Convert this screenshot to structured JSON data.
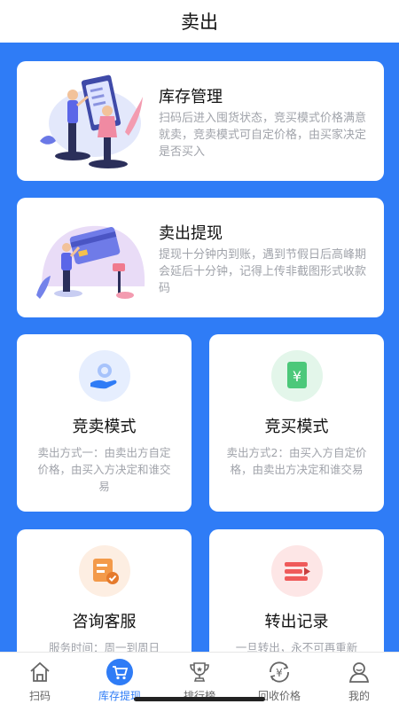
{
  "header": {
    "title": "卖出"
  },
  "cards": {
    "inventory": {
      "title": "库存管理",
      "desc": "扫码后进入囤货状态，竞买模式价格满意就卖，竞卖模式可自定价格，由买家决定是否买入"
    },
    "withdraw": {
      "title": "卖出提现",
      "desc": "提现十分钟内到账，遇到节假日后高峰期会延后十分钟，记得上传非截图形式收款码"
    },
    "auction_sell": {
      "title": "竞卖模式",
      "desc": "卖出方式一：由卖出方自定价格，由买入方决定和谁交易"
    },
    "auction_buy": {
      "title": "竞买模式",
      "desc": "卖出方式2：由买入方自定价格，由卖出方决定和谁交易"
    },
    "service": {
      "title": "咨询客服",
      "desc": "服务时间：周一到周日"
    },
    "transfer": {
      "title": "转出记录",
      "desc": "一旦转出，永不可再重新"
    }
  },
  "tabbar": {
    "items": [
      {
        "label": "扫码",
        "icon": "home-icon"
      },
      {
        "label": "库存提现",
        "icon": "cart-icon"
      },
      {
        "label": "排行榜",
        "icon": "trophy-icon"
      },
      {
        "label": "回收价格",
        "icon": "yen-recycle-icon"
      },
      {
        "label": "我的",
        "icon": "user-icon"
      }
    ],
    "active_index": 1
  },
  "colors": {
    "accent": "#2f7cf6",
    "muted_text": "#a0a3aa"
  }
}
